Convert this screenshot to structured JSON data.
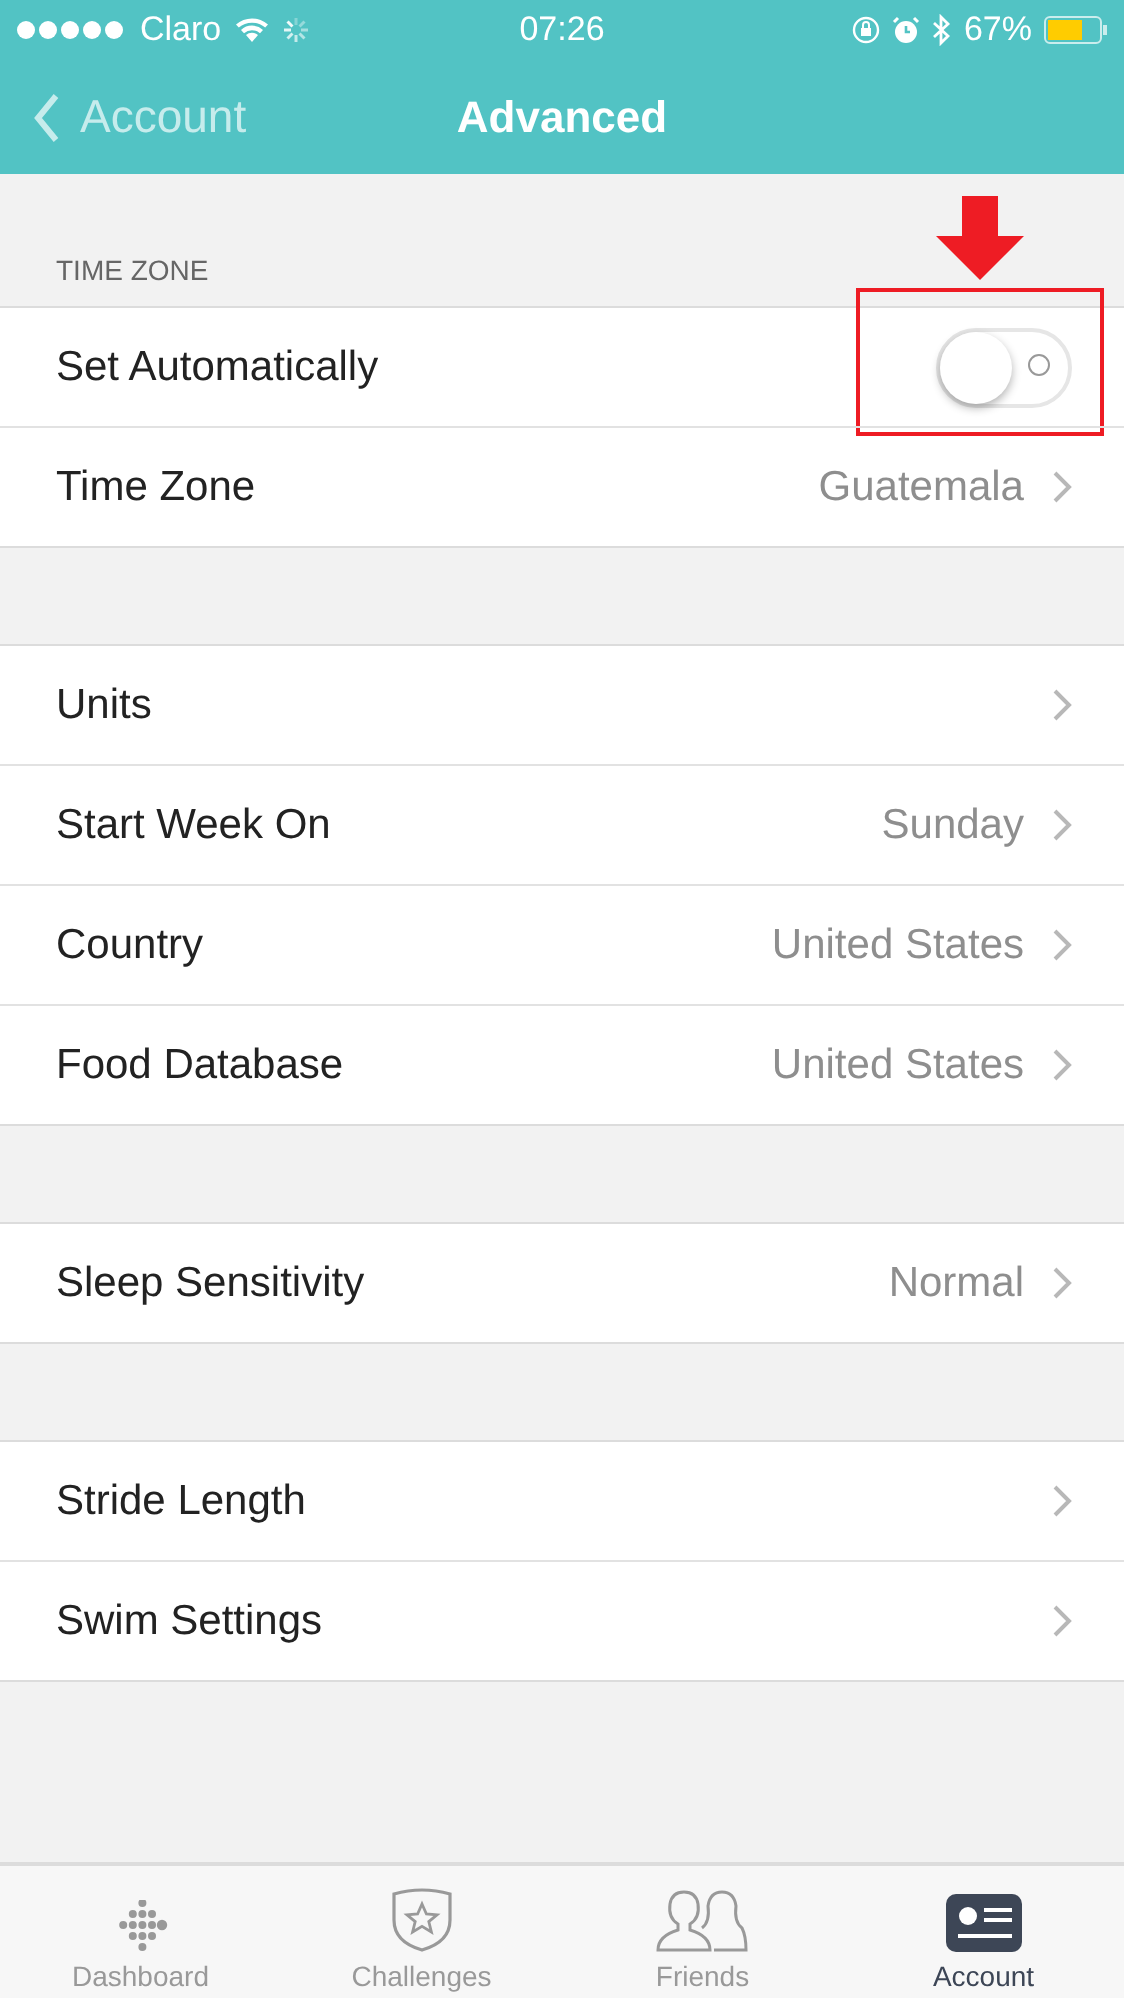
{
  "status_bar": {
    "carrier": "Claro",
    "time": "07:26",
    "battery": "67%"
  },
  "nav": {
    "back": "Account",
    "title": "Advanced"
  },
  "sections": [
    {
      "header": "TIME ZONE",
      "rows": [
        {
          "kind": "toggle",
          "label": "Set Automatically",
          "on": false,
          "highlighted": true
        },
        {
          "kind": "link",
          "label": "Time Zone",
          "value": "Guatemala"
        }
      ]
    },
    {
      "rows": [
        {
          "kind": "link",
          "label": "Units"
        },
        {
          "kind": "link",
          "label": "Start Week On",
          "value": "Sunday"
        },
        {
          "kind": "link",
          "label": "Country",
          "value": "United States"
        },
        {
          "kind": "link",
          "label": "Food Database",
          "value": "United States"
        }
      ]
    },
    {
      "rows": [
        {
          "kind": "link",
          "label": "Sleep Sensitivity",
          "value": "Normal"
        }
      ]
    },
    {
      "rows": [
        {
          "kind": "link",
          "label": "Stride Length"
        },
        {
          "kind": "link",
          "label": "Swim Settings"
        }
      ]
    }
  ],
  "tabs": [
    {
      "label": "Dashboard",
      "kind": "dashboard",
      "selected": false
    },
    {
      "label": "Challenges",
      "kind": "challenges",
      "selected": false
    },
    {
      "label": "Friends",
      "kind": "friends",
      "selected": false
    },
    {
      "label": "Account",
      "kind": "account",
      "selected": true
    }
  ]
}
